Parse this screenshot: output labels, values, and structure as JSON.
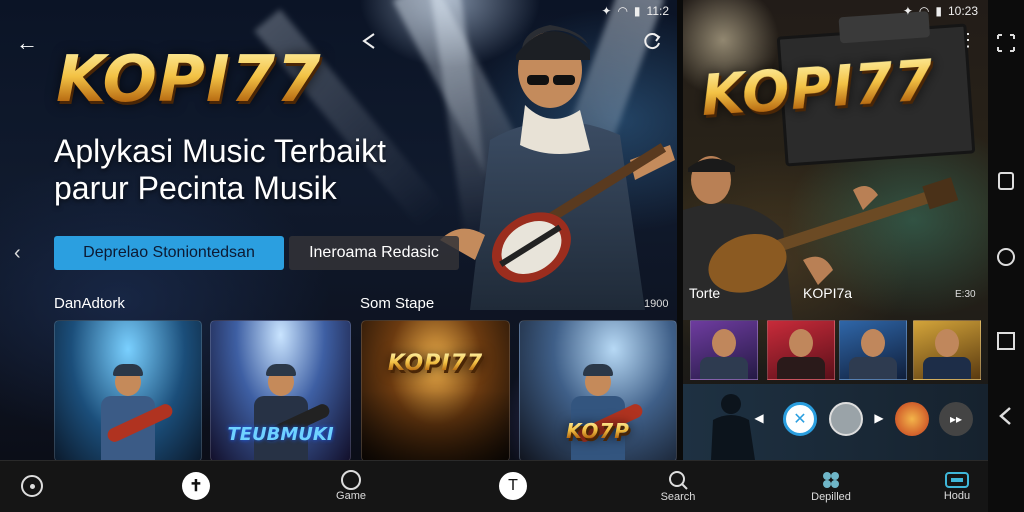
{
  "left_panel": {
    "status": {
      "time": "11:2"
    },
    "logo": "KOPI77",
    "headline": {
      "line1": "Aplykasi Music Terbaikt",
      "line2": "parur Pecinta Musik"
    },
    "buttons": {
      "primary": "Deprelao Stoniontedsan",
      "secondary": "Ineroama Redasic"
    },
    "sections": [
      {
        "label": "DanAdtork",
        "count": ""
      },
      {
        "label": "Som Stape",
        "count": "1900"
      }
    ],
    "cards": [
      {
        "caption": "",
        "overlay": ""
      },
      {
        "caption": "",
        "overlay": "TEUBMUKI"
      },
      {
        "caption": "",
        "overlay": "KOPI77"
      },
      {
        "caption": "",
        "overlay": "KO7P"
      }
    ]
  },
  "right_panel": {
    "status": {
      "time": "10:23"
    },
    "logo": "KOPI77",
    "labels": {
      "left": "Torte",
      "center": "KOPI7a",
      "right": "E:30"
    }
  },
  "bottom_nav": [
    {
      "label": "",
      "icon": "circle-dot-icon"
    },
    {
      "label": "",
      "icon": "cross-icon"
    },
    {
      "label": "Game",
      "icon": "circle-icon"
    },
    {
      "label": "",
      "icon": "t-icon"
    },
    {
      "label": "Search",
      "icon": "search-icon"
    },
    {
      "label": "Depilled",
      "icon": "flower-icon"
    },
    {
      "label": "Hodu",
      "icon": "screen-icon"
    }
  ],
  "colors": {
    "accent": "#2b9fe0",
    "logo_gold": "#f3c245",
    "bar": "#151515"
  }
}
